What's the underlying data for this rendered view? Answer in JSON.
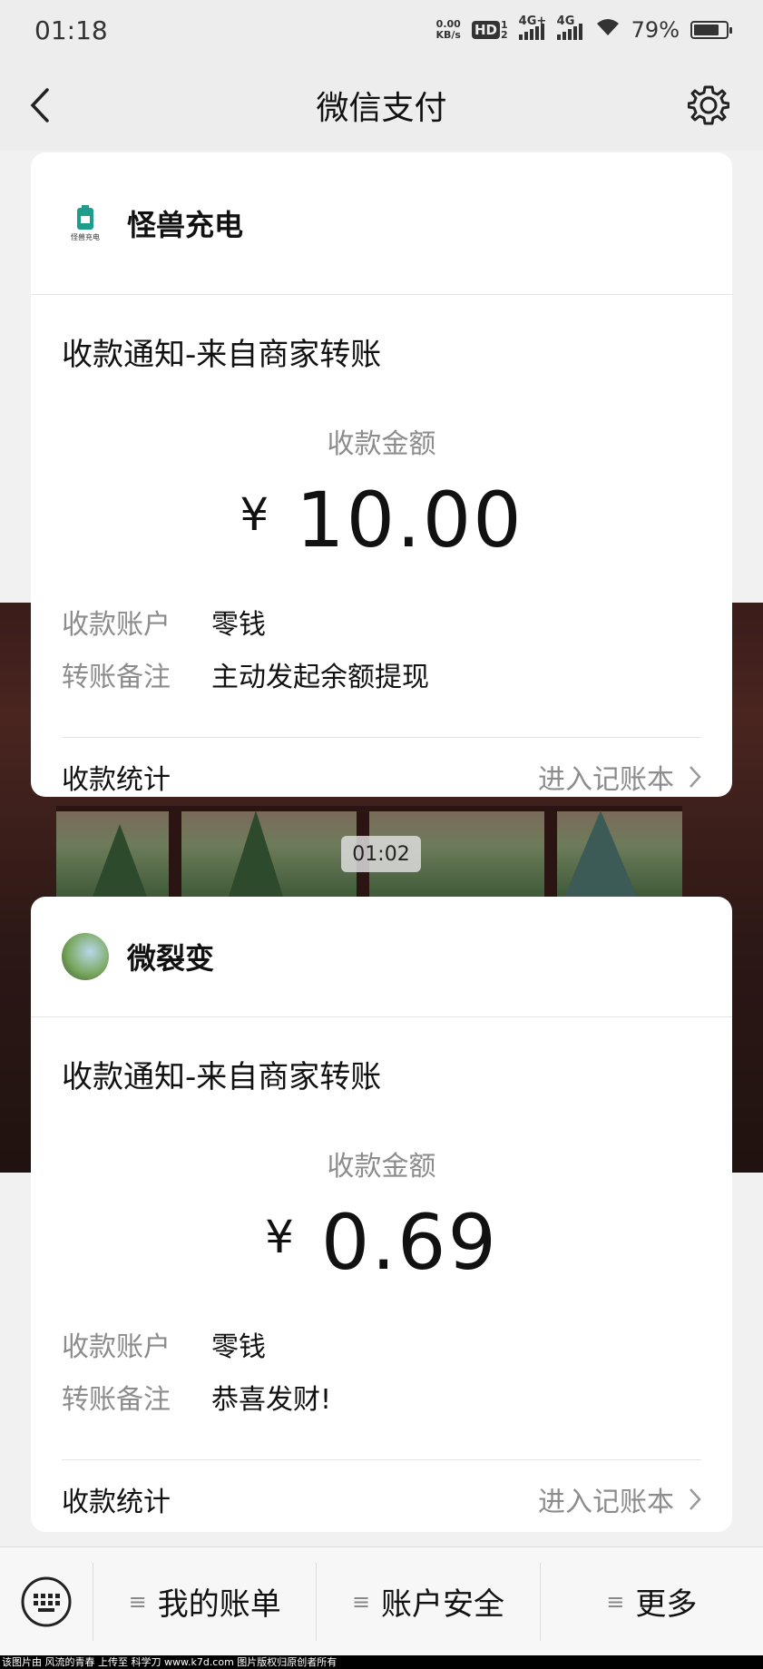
{
  "status_bar": {
    "time": "01:18",
    "net_speed_value": "0.00",
    "net_speed_unit": "KB/s",
    "hd_label": "HD",
    "hd_sup": "1",
    "hd_sub": "2",
    "signal1_label": "4G+",
    "signal2_label": "4G",
    "battery_percent_text": "79%",
    "battery_level": 0.79
  },
  "nav": {
    "title": "微信支付",
    "back_icon": "chevron-left-icon",
    "settings_icon": "gear-icon"
  },
  "video_overlay": {
    "time": "01:02"
  },
  "cards": [
    {
      "merchant": "怪兽充电",
      "logo_caption": "怪兽充电",
      "title": "收款通知-来自商家转账",
      "amount_label": "收款金额",
      "currency": "¥",
      "amount": "10.00",
      "rows": [
        {
          "key": "收款账户",
          "value": "零钱"
        },
        {
          "key": "转账备注",
          "value": "主动发起余额提现"
        }
      ],
      "stats_label": "收款统计",
      "stats_link": "进入记账本"
    },
    {
      "merchant": "微裂变",
      "title": "收款通知-来自商家转账",
      "amount_label": "收款金额",
      "currency": "¥",
      "amount": "0.69",
      "rows": [
        {
          "key": "收款账户",
          "value": "零钱"
        },
        {
          "key": "转账备注",
          "value": "恭喜发财!"
        }
      ],
      "stats_label": "收款统计",
      "stats_link": "进入记账本"
    }
  ],
  "bottom_menu": {
    "keyboard_icon": "keyboard-icon",
    "items": [
      {
        "label": "我的账单"
      },
      {
        "label": "账户安全"
      },
      {
        "label": "更多"
      }
    ]
  },
  "watermark": "该图片由 风流的青春 上传至 科学刀 www.k7d.com 图片版权归原创者所有",
  "colors": {
    "background": "#ededed",
    "card": "#ffffff",
    "muted_text": "#8c8c8c",
    "brand_green": "#1aad19"
  }
}
